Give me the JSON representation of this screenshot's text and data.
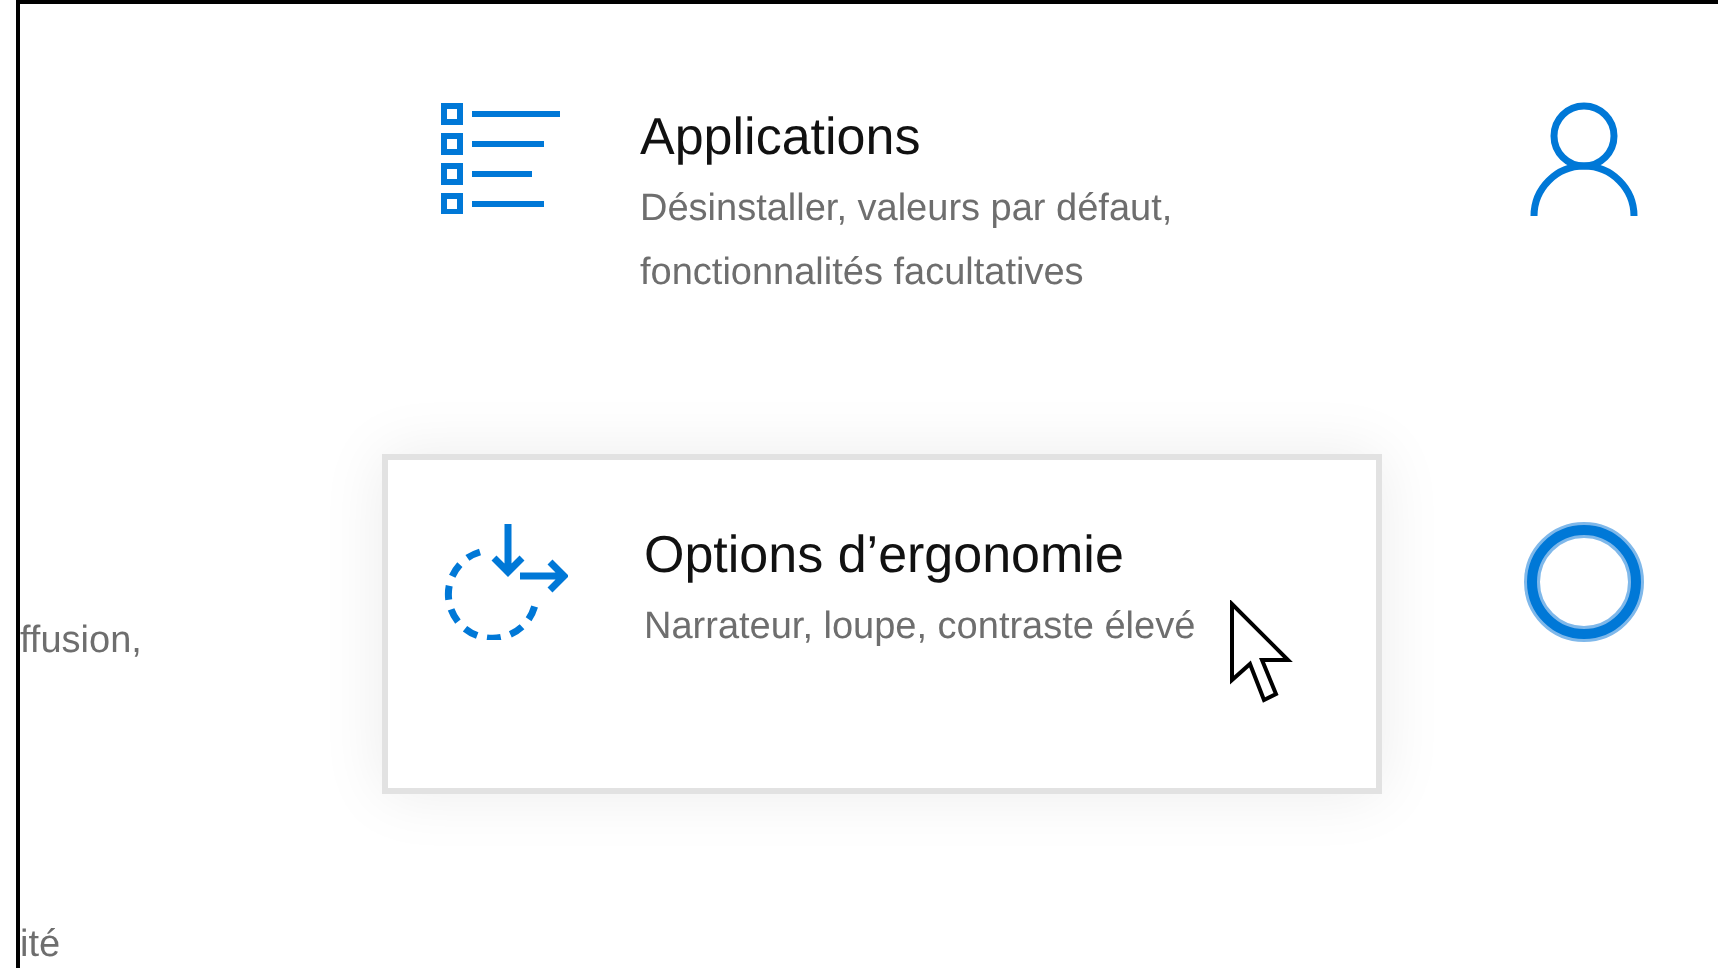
{
  "left_column": [
    {
      "text": "ffusion,"
    },
    {
      "text": "ité"
    }
  ],
  "tiles": [
    {
      "title": "Applications",
      "subtitle": "Désinstaller, valeurs par défaut, fonctionnalités facultatives",
      "kind": "apps",
      "hovered": false
    },
    {
      "title": "Options d’ergonomie",
      "subtitle": "Narrateur, loupe, contraste élevé",
      "kind": "ease",
      "hovered": true
    }
  ],
  "right_column": [
    {
      "kind": "person"
    },
    {
      "kind": "ring"
    }
  ]
}
